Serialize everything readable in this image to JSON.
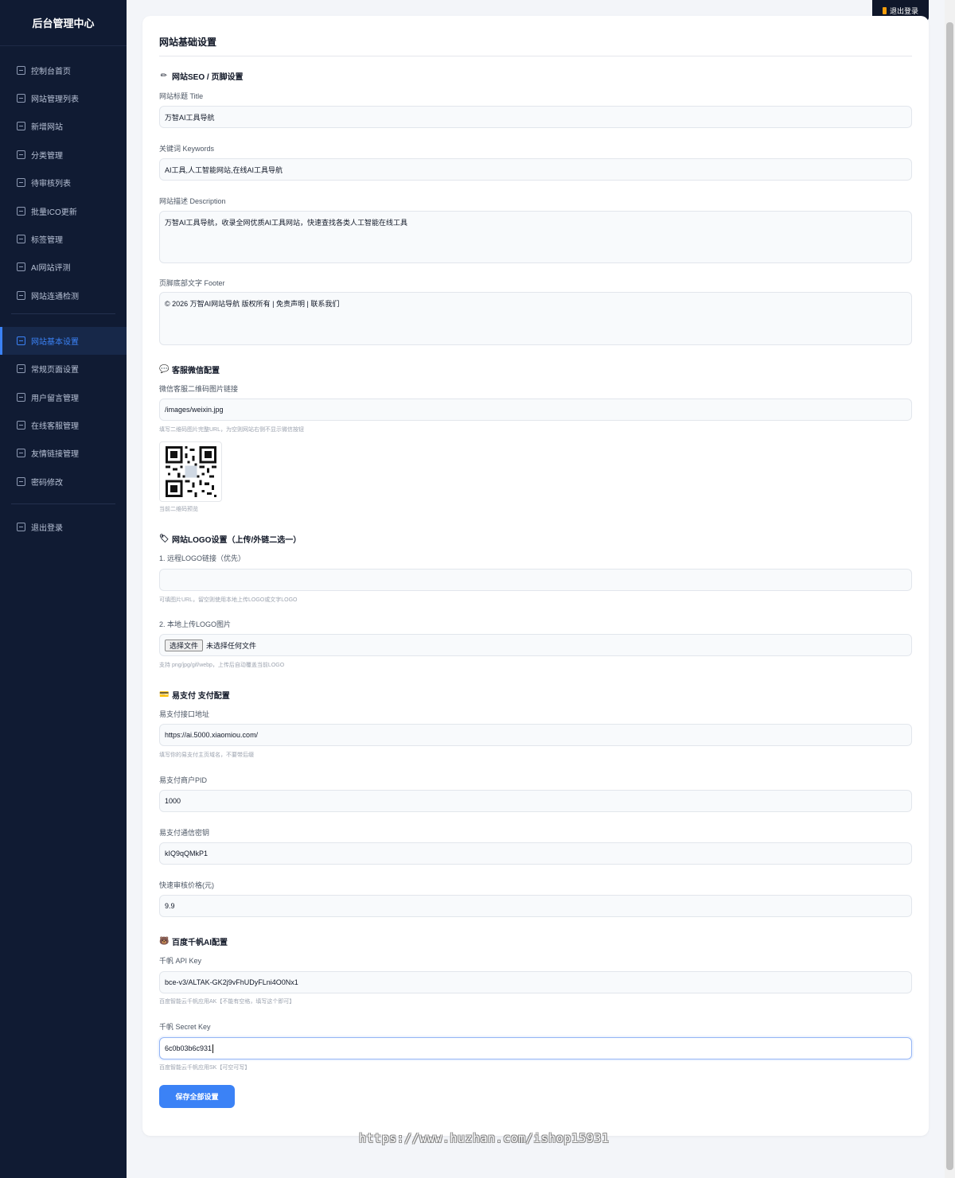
{
  "sidebar": {
    "brand": "后台管理中心",
    "items": [
      {
        "label": "控制台首页",
        "name": "dashboard"
      },
      {
        "label": "网站管理列表",
        "name": "site-list"
      },
      {
        "label": "新增网站",
        "name": "add-site"
      },
      {
        "label": "分类管理",
        "name": "categories"
      },
      {
        "label": "待审核列表",
        "name": "pending-list"
      },
      {
        "label": "批量ICO更新",
        "name": "batch-ico"
      },
      {
        "label": "标签管理",
        "name": "tags"
      },
      {
        "label": "AI网站评测",
        "name": "ai-review"
      },
      {
        "label": "网站连通检测",
        "name": "connectivity"
      },
      {
        "label": "网站基本设置",
        "name": "basic-settings",
        "active": true
      },
      {
        "label": "常规页面设置",
        "name": "page-settings"
      },
      {
        "label": "用户留言管理",
        "name": "messages"
      },
      {
        "label": "在线客服管理",
        "name": "customer-service"
      },
      {
        "label": "友情链接管理",
        "name": "friend-links"
      },
      {
        "label": "密码修改",
        "name": "password"
      },
      {
        "label": "退出登录",
        "name": "logout"
      }
    ]
  },
  "header": {
    "logout_label": "退出登录"
  },
  "page": {
    "title": "网站基础设置",
    "save_label": "保存全部设置"
  },
  "seo": {
    "heading": "网站SEO / 页脚设置",
    "title_label": "网站标题 Title",
    "title_value": "万智AI工具导航",
    "keywords_label": "关键词 Keywords",
    "keywords_value": "AI工具,人工智能网站,在线AI工具导航",
    "desc_label": "网站描述 Description",
    "desc_value": "万智AI工具导航，收录全网优质AI工具网站，快速查找各类人工智能在线工具",
    "footer_label": "页脚底部文字 Footer",
    "footer_value": "© 2026 万智AI网站导航 版权所有 | 免责声明 | 联系我们"
  },
  "wechat": {
    "heading": "客服微信配置",
    "qr_label": "微信客服二维码图片链接",
    "qr_value": "/images/weixin.jpg",
    "qr_hint": "填写二维码图片完整URL，为空则网站右侧不显示微信按钮",
    "preview_caption": "当前二维码预览"
  },
  "logo": {
    "heading": "网站LOGO设置（上传/外链二选一）",
    "remote_label": "1. 远程LOGO链接（优先）",
    "remote_value": "",
    "remote_hint": "可填图片URL，留空则使用本地上传LOGO或文字LOGO",
    "upload_label": "2. 本地上传LOGO图片",
    "choose_button": "选择文件",
    "no_file": "未选择任何文件",
    "upload_hint": "支持 png/jpg/gif/webp，上传后自动覆盖当前LOGO"
  },
  "pay": {
    "heading": "易支付 支付配置",
    "api_label": "易支付接口地址",
    "api_value": "https://ai.5000.xiaomiou.com/",
    "api_hint": "填写你的易支付主页域名，不要带后缀",
    "pid_label": "易支付商户PID",
    "pid_value": "1000",
    "key_label": "易支付通信密钥",
    "key_value": "kIQ9qQMkP1",
    "price_label": "快速审核价格(元)",
    "price_value": "9.9"
  },
  "qianfan": {
    "heading": "百度千帆AI配置",
    "apikey_label": "千帆 API Key",
    "apikey_value": "bce-v3/ALTAK-GK2j9vFhUDyFLni4O0Nx1",
    "apikey_hint": "百度智能云千帆应用AK【不能有空格，填写这个即可】",
    "secret_label": "千帆 Secret Key",
    "secret_value": "6c0b03b6c931",
    "secret_hint": "百度智能云千帆应用SK【可空可写】"
  },
  "watermark": "https://www.huzhan.com/ishop15931",
  "icons": {
    "seo": "pencil-icon",
    "wechat": "speech-bubble-icon",
    "logo": "label-tag-icon",
    "pay": "credit-card-icon",
    "qianfan": "bear-face-icon",
    "logout": "door-icon"
  },
  "colors": {
    "sidebar_bg": "#101b33",
    "accent": "#3b82f6",
    "page_bg": "#f3f5f9"
  }
}
